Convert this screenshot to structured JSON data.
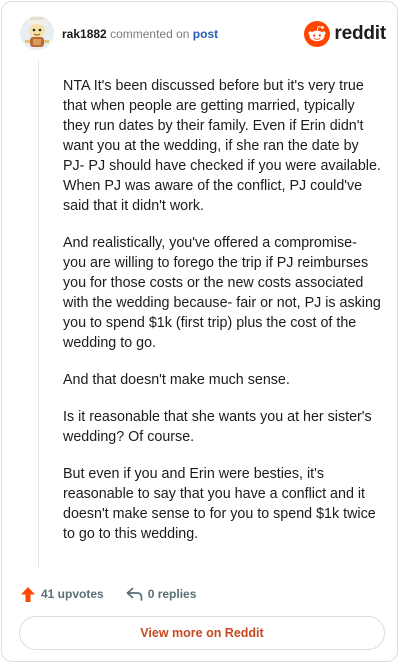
{
  "comment": {
    "username": "rak1882",
    "action_text": "commented on",
    "target_link": "post",
    "paragraphs": [
      "NTA It's been discussed before but it's very true that when people are getting married, typically they run dates by their family. Even if Erin didn't want you at the wedding, if she ran the date by PJ- PJ should have checked if you were available. When PJ was aware of the conflict, PJ could've said that it didn't work.",
      "And realistically, you've offered a compromise- you are willing to forego the trip if PJ reimburses you for those costs or the new costs associated with the wedding because- fair or not, PJ is asking you to spend $1k (first trip) plus the cost of the wedding to go.",
      "And that doesn't make much sense.",
      "Is it reasonable that she wants you at her sister's wedding? Of course.",
      "But even if you and Erin were besties, it's reasonable to say that you have a conflict and it doesn't make sense to for you to spend $1k twice to go to this wedding."
    ],
    "upvotes_label": "41 upvotes",
    "replies_label": "0 replies"
  },
  "brand": {
    "name": "reddit",
    "icon": "reddit-snoo-icon",
    "color": "#ff4500"
  },
  "footer": {
    "view_more_label": "View more on Reddit"
  },
  "colors": {
    "upvote": "#ff4500",
    "link": "#2a5db0",
    "button_text": "#c44a1f"
  }
}
